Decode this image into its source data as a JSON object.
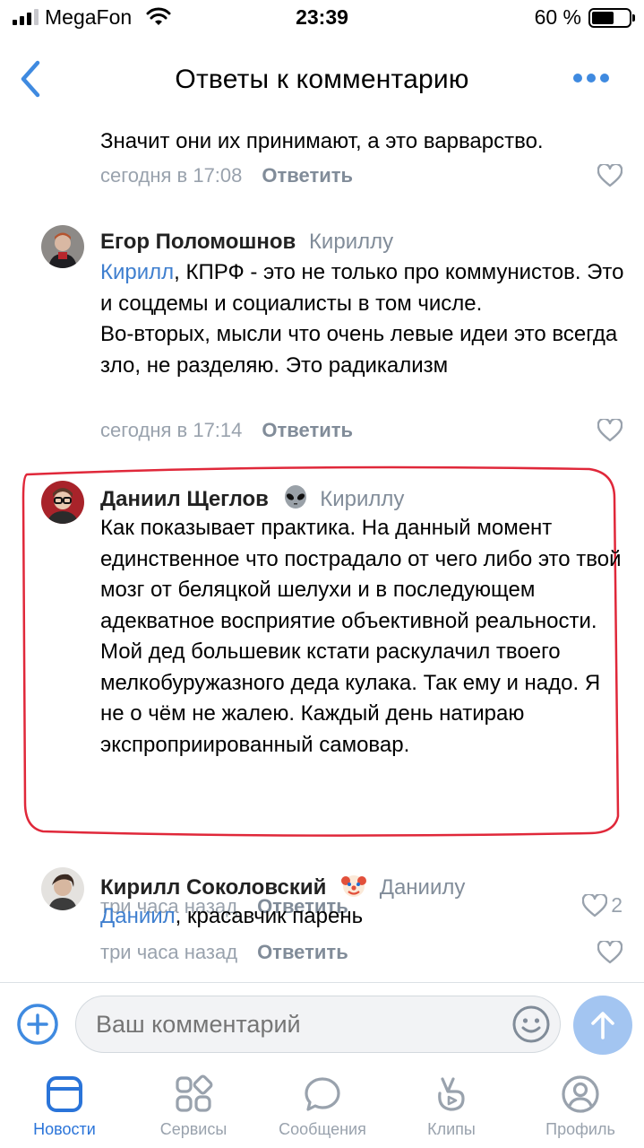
{
  "status_bar": {
    "carrier": "MegaFon",
    "time": "23:39",
    "battery_percent": "60 %",
    "battery_level": 0.6
  },
  "header": {
    "title": "Ответы к комментарию",
    "back_icon": "chevron-left-icon",
    "more_icon": "more-dots-icon"
  },
  "comments": [
    {
      "text": "Значит они их принимают, а это варварство.",
      "time": "сегодня в 17:08",
      "reply_label": "Ответить",
      "likes": ""
    },
    {
      "author": "Егор Поломошнов",
      "reply_to": "Кириллу",
      "mention": "Кирилл",
      "text_after_mention": ", КПРФ - это не только про коммунистов. Это и соцдемы и социалисты в том числе.",
      "text_line2": "Во-вторых, мысли что очень левые идеи это всегда зло, не разделяю. Это радикализм",
      "time": "сегодня в 17:14",
      "reply_label": "Ответить",
      "likes": ""
    },
    {
      "author": "Даниил Щеглов",
      "badge": "👽",
      "reply_to": "Кириллу",
      "text": "Как показывает практика. На данный момент единственное что пострадало от чего либо это твой мозг от беляцкой шелухи и в последующем адекватное восприятие объективной реальности. Мой дед большевик кстати раскулачил твоего мелкобуружазного деда кулака. Так ему и надо. Я не о чём не жалею. Каждый день натираю экспроприированный самовар.",
      "time": "три часа назад",
      "reply_label": "Ответить",
      "likes": "2"
    },
    {
      "author": "Кирилл Соколовский",
      "badge": "🤡",
      "reply_to": "Даниилу",
      "mention": "Даниил",
      "text_after_mention": ", красавчик парень",
      "time": "три часа назад",
      "reply_label": "Ответить",
      "likes": ""
    }
  ],
  "composer": {
    "placeholder": "Ваш комментарий"
  },
  "tabbar": {
    "items": [
      {
        "label": "Новости",
        "icon": "news-icon",
        "active": true
      },
      {
        "label": "Сервисы",
        "icon": "services-icon",
        "active": false
      },
      {
        "label": "Сообщения",
        "icon": "messages-icon",
        "active": false
      },
      {
        "label": "Клипы",
        "icon": "clips-icon",
        "active": false
      },
      {
        "label": "Профиль",
        "icon": "profile-icon",
        "active": false
      }
    ]
  },
  "colors": {
    "accent": "#3f8ae0",
    "highlight_stroke": "#e0283a",
    "secondary_text": "#818c99"
  }
}
